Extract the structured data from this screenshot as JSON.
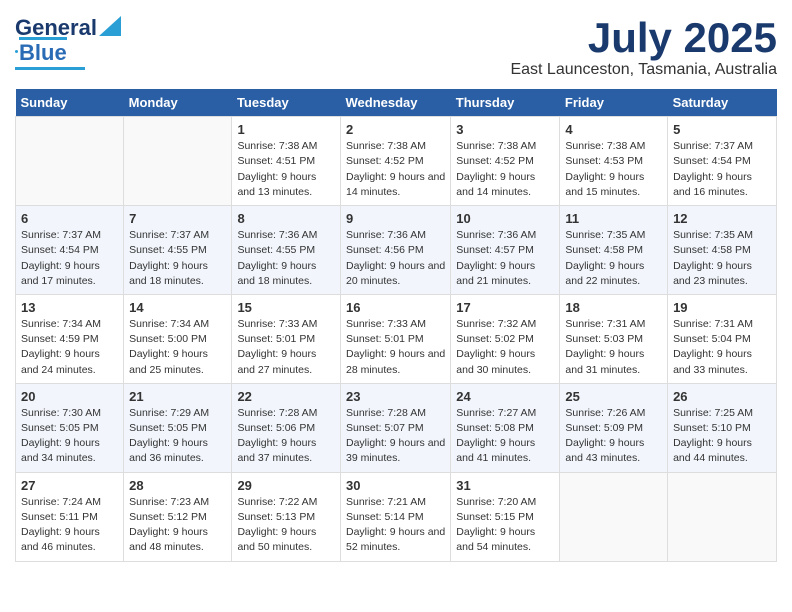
{
  "logo": {
    "line1": "General",
    "line2": "Blue"
  },
  "title": "July 2025",
  "subtitle": "East Launceston, Tasmania, Australia",
  "days_header": [
    "Sunday",
    "Monday",
    "Tuesday",
    "Wednesday",
    "Thursday",
    "Friday",
    "Saturday"
  ],
  "weeks": [
    [
      {
        "day": "",
        "detail": ""
      },
      {
        "day": "",
        "detail": ""
      },
      {
        "day": "1",
        "detail": "Sunrise: 7:38 AM\nSunset: 4:51 PM\nDaylight: 9 hours and 13 minutes."
      },
      {
        "day": "2",
        "detail": "Sunrise: 7:38 AM\nSunset: 4:52 PM\nDaylight: 9 hours and 14 minutes."
      },
      {
        "day": "3",
        "detail": "Sunrise: 7:38 AM\nSunset: 4:52 PM\nDaylight: 9 hours and 14 minutes."
      },
      {
        "day": "4",
        "detail": "Sunrise: 7:38 AM\nSunset: 4:53 PM\nDaylight: 9 hours and 15 minutes."
      },
      {
        "day": "5",
        "detail": "Sunrise: 7:37 AM\nSunset: 4:54 PM\nDaylight: 9 hours and 16 minutes."
      }
    ],
    [
      {
        "day": "6",
        "detail": "Sunrise: 7:37 AM\nSunset: 4:54 PM\nDaylight: 9 hours and 17 minutes."
      },
      {
        "day": "7",
        "detail": "Sunrise: 7:37 AM\nSunset: 4:55 PM\nDaylight: 9 hours and 18 minutes."
      },
      {
        "day": "8",
        "detail": "Sunrise: 7:36 AM\nSunset: 4:55 PM\nDaylight: 9 hours and 18 minutes."
      },
      {
        "day": "9",
        "detail": "Sunrise: 7:36 AM\nSunset: 4:56 PM\nDaylight: 9 hours and 20 minutes."
      },
      {
        "day": "10",
        "detail": "Sunrise: 7:36 AM\nSunset: 4:57 PM\nDaylight: 9 hours and 21 minutes."
      },
      {
        "day": "11",
        "detail": "Sunrise: 7:35 AM\nSunset: 4:58 PM\nDaylight: 9 hours and 22 minutes."
      },
      {
        "day": "12",
        "detail": "Sunrise: 7:35 AM\nSunset: 4:58 PM\nDaylight: 9 hours and 23 minutes."
      }
    ],
    [
      {
        "day": "13",
        "detail": "Sunrise: 7:34 AM\nSunset: 4:59 PM\nDaylight: 9 hours and 24 minutes."
      },
      {
        "day": "14",
        "detail": "Sunrise: 7:34 AM\nSunset: 5:00 PM\nDaylight: 9 hours and 25 minutes."
      },
      {
        "day": "15",
        "detail": "Sunrise: 7:33 AM\nSunset: 5:01 PM\nDaylight: 9 hours and 27 minutes."
      },
      {
        "day": "16",
        "detail": "Sunrise: 7:33 AM\nSunset: 5:01 PM\nDaylight: 9 hours and 28 minutes."
      },
      {
        "day": "17",
        "detail": "Sunrise: 7:32 AM\nSunset: 5:02 PM\nDaylight: 9 hours and 30 minutes."
      },
      {
        "day": "18",
        "detail": "Sunrise: 7:31 AM\nSunset: 5:03 PM\nDaylight: 9 hours and 31 minutes."
      },
      {
        "day": "19",
        "detail": "Sunrise: 7:31 AM\nSunset: 5:04 PM\nDaylight: 9 hours and 33 minutes."
      }
    ],
    [
      {
        "day": "20",
        "detail": "Sunrise: 7:30 AM\nSunset: 5:05 PM\nDaylight: 9 hours and 34 minutes."
      },
      {
        "day": "21",
        "detail": "Sunrise: 7:29 AM\nSunset: 5:05 PM\nDaylight: 9 hours and 36 minutes."
      },
      {
        "day": "22",
        "detail": "Sunrise: 7:28 AM\nSunset: 5:06 PM\nDaylight: 9 hours and 37 minutes."
      },
      {
        "day": "23",
        "detail": "Sunrise: 7:28 AM\nSunset: 5:07 PM\nDaylight: 9 hours and 39 minutes."
      },
      {
        "day": "24",
        "detail": "Sunrise: 7:27 AM\nSunset: 5:08 PM\nDaylight: 9 hours and 41 minutes."
      },
      {
        "day": "25",
        "detail": "Sunrise: 7:26 AM\nSunset: 5:09 PM\nDaylight: 9 hours and 43 minutes."
      },
      {
        "day": "26",
        "detail": "Sunrise: 7:25 AM\nSunset: 5:10 PM\nDaylight: 9 hours and 44 minutes."
      }
    ],
    [
      {
        "day": "27",
        "detail": "Sunrise: 7:24 AM\nSunset: 5:11 PM\nDaylight: 9 hours and 46 minutes."
      },
      {
        "day": "28",
        "detail": "Sunrise: 7:23 AM\nSunset: 5:12 PM\nDaylight: 9 hours and 48 minutes."
      },
      {
        "day": "29",
        "detail": "Sunrise: 7:22 AM\nSunset: 5:13 PM\nDaylight: 9 hours and 50 minutes."
      },
      {
        "day": "30",
        "detail": "Sunrise: 7:21 AM\nSunset: 5:14 PM\nDaylight: 9 hours and 52 minutes."
      },
      {
        "day": "31",
        "detail": "Sunrise: 7:20 AM\nSunset: 5:15 PM\nDaylight: 9 hours and 54 minutes."
      },
      {
        "day": "",
        "detail": ""
      },
      {
        "day": "",
        "detail": ""
      }
    ]
  ]
}
